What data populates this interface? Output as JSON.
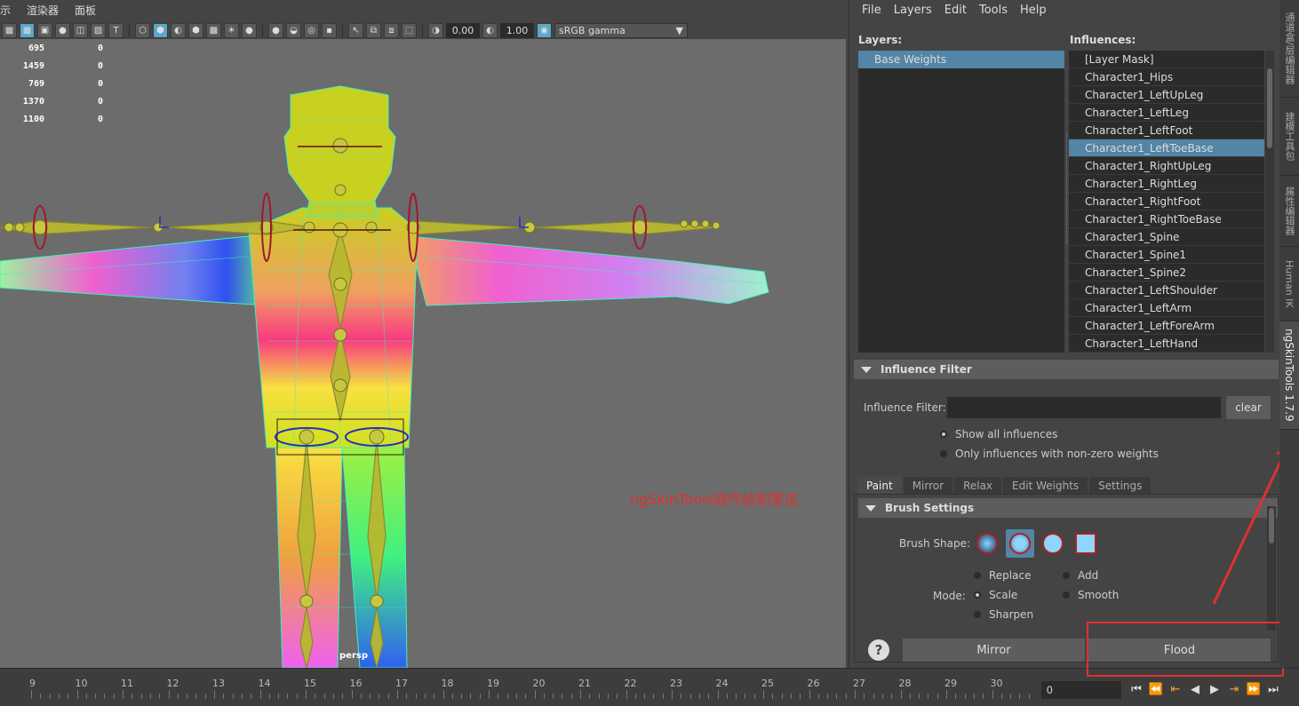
{
  "viewport": {
    "menu": [
      "示",
      "渲染器",
      "面板"
    ],
    "fields": {
      "value1": "0.00",
      "value2": "1.00",
      "color_space": "sRGB gamma"
    },
    "stats": [
      {
        "a": "695",
        "b": "0"
      },
      {
        "a": "1459",
        "b": "0"
      },
      {
        "a": "769",
        "b": "0"
      },
      {
        "a": "1370",
        "b": "0"
      },
      {
        "a": "1100",
        "b": "0"
      }
    ],
    "annotation": "ngSkinTools插件绘制蒙皮",
    "camera_label": "persp"
  },
  "timeline": {
    "ticks": [
      "9",
      "10",
      "11",
      "12",
      "13",
      "14",
      "15",
      "16",
      "17",
      "18",
      "19",
      "20",
      "21",
      "22",
      "23",
      "24",
      "25",
      "26",
      "27",
      "28",
      "29",
      "30"
    ],
    "current_frame": "0"
  },
  "panel": {
    "menu": [
      "File",
      "Layers",
      "Edit",
      "Tools",
      "Help"
    ],
    "layers_title": "Layers:",
    "influences_title": "Influences:",
    "layers": [
      {
        "label": "Base Weights",
        "selected": true
      }
    ],
    "influences": [
      {
        "label": "[Layer Mask]",
        "selected": false
      },
      {
        "label": "Character1_Hips",
        "selected": false
      },
      {
        "label": "Character1_LeftUpLeg",
        "selected": false
      },
      {
        "label": "Character1_LeftLeg",
        "selected": false
      },
      {
        "label": "Character1_LeftFoot",
        "selected": false
      },
      {
        "label": "Character1_LeftToeBase",
        "selected": true
      },
      {
        "label": "Character1_RightUpLeg",
        "selected": false
      },
      {
        "label": "Character1_RightLeg",
        "selected": false
      },
      {
        "label": "Character1_RightFoot",
        "selected": false
      },
      {
        "label": "Character1_RightToeBase",
        "selected": false
      },
      {
        "label": "Character1_Spine",
        "selected": false
      },
      {
        "label": "Character1_Spine1",
        "selected": false
      },
      {
        "label": "Character1_Spine2",
        "selected": false
      },
      {
        "label": "Character1_LeftShoulder",
        "selected": false
      },
      {
        "label": "Character1_LeftArm",
        "selected": false
      },
      {
        "label": "Character1_LeftForeArm",
        "selected": false
      },
      {
        "label": "Character1_LeftHand",
        "selected": false
      }
    ],
    "influence_filter": {
      "header": "Influence Filter",
      "label": "Influence Filter:",
      "value": "",
      "clear": "clear",
      "opt_all": "Show all influences",
      "opt_nonzero": "Only influences with non-zero weights"
    },
    "tabs": [
      "Paint",
      "Mirror",
      "Relax",
      "Edit Weights",
      "Settings"
    ],
    "brush": {
      "header": "Brush Settings",
      "shape_label": "Brush Shape:",
      "mode_label": "Mode:",
      "modes": {
        "replace": "Replace",
        "add": "Add",
        "scale": "Scale",
        "smooth": "Smooth",
        "sharpen": "Sharpen"
      }
    },
    "buttons": {
      "help": "?",
      "mirror": "Mirror",
      "flood": "Flood"
    }
  },
  "side_tabs": [
    "通道盒/层编辑器",
    "建模工具包",
    "属性编辑器",
    "Human IK",
    "ngSkinTools 1.7.9"
  ]
}
